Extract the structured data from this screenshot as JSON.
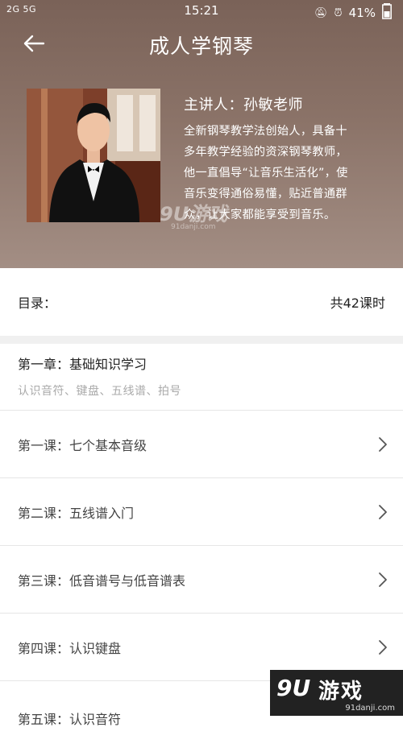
{
  "status_bar": {
    "signal_left": "2G 5G",
    "time": "15:21",
    "battery": "41%"
  },
  "header": {
    "back_icon": "back-arrow-icon",
    "title": "成人学钢琴"
  },
  "teacher": {
    "name_line": "主讲人：孙敏老师",
    "bio_lines": [
      "全新钢琴教学法创始人，具备十",
      "多年教学经验的资深钢琴教师，",
      "他一直倡导“让音乐生活化”，使",
      "音乐变得通俗易懂，贴近普通群",
      "众，让大家都能享受到音乐。"
    ]
  },
  "watermark_top": {
    "logo": "9U游戏",
    "url": "91danji.com"
  },
  "toc": {
    "label": "目录：",
    "count": "共42课时"
  },
  "chapter": {
    "title": "第一章：基础知识学习",
    "subtitle": "认识音符、键盘、五线谱、拍号"
  },
  "lessons": [
    {
      "label": "第一课：七个基本音级"
    },
    {
      "label": "第二课：五线谱入门"
    },
    {
      "label": "第三课：低音谱号与低音谱表"
    },
    {
      "label": "第四课：认识键盘"
    },
    {
      "label": "第五课：认识音符"
    }
  ],
  "watermark_bottom": {
    "logo": "9U",
    "brand": "游戏",
    "url": "91danji.com"
  },
  "colors": {
    "hero": "#8b7368",
    "divider": "#e6e6e6",
    "muted": "#aaaaaa"
  }
}
